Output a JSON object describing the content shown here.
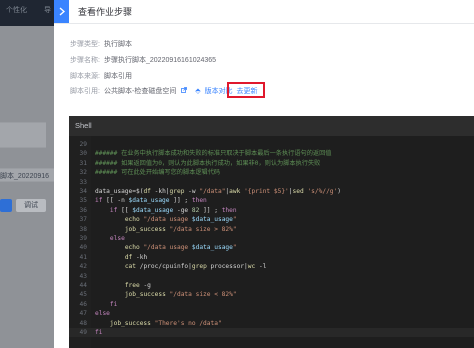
{
  "background_app": {
    "top_nav_items": [
      "个性化",
      "导"
    ],
    "step_name_value": "脚本_20220916",
    "button_label": "调试"
  },
  "panel": {
    "title": "查看作业步骤",
    "collapse_icon": "chevron-right-icon",
    "fields": [
      {
        "label": "步骤类型:",
        "value": "执行脚本"
      },
      {
        "label": "步骤名称:",
        "value": "步骤执行脚本_20220916161024365"
      },
      {
        "label": "脚本来源:",
        "value": "脚本引用"
      },
      {
        "label": "脚本引用:",
        "value": "公共脚本-检查磁盘空间",
        "link_label": "版本对比",
        "update_label": "去更新"
      }
    ]
  },
  "editor": {
    "language_tab": "Shell",
    "lines": [
      {
        "n": "29",
        "text": "",
        "kind": "plain"
      },
      {
        "n": "30",
        "text": "###### 在业务中执行脚本成功和失败的标准只取决于脚本最后一条执行语句的返回值",
        "kind": "comment"
      },
      {
        "n": "31",
        "text": "###### 如果返回值为0，则认为此脚本执行成功，如果非0，则认为脚本执行失败",
        "kind": "comment"
      },
      {
        "n": "32",
        "text": "###### 可在此处开始编写您的脚本逻辑代码",
        "kind": "comment"
      },
      {
        "n": "33",
        "text": "",
        "kind": "plain"
      },
      {
        "n": "34",
        "text": "data_usage=$(df -kh|grep -w \"/data\"|awk '{print $5}'|sed 's/%//g')",
        "kind": "assign"
      },
      {
        "n": "35",
        "text": "if [[ -n $data_usage ]] ; then",
        "kind": "if"
      },
      {
        "n": "36",
        "text": "    if [[ $data_usage -ge 82 ]] ; then",
        "kind": "if"
      },
      {
        "n": "37",
        "text": "        echo \"/data usage $data_usage\"",
        "kind": "echo"
      },
      {
        "n": "38",
        "text": "        job_success \"/data size > 82%\"",
        "kind": "call"
      },
      {
        "n": "39",
        "text": "    else",
        "kind": "kw"
      },
      {
        "n": "40",
        "text": "        echo \"/data usage $data_usage\"",
        "kind": "echo"
      },
      {
        "n": "41",
        "text": "        df -kh",
        "kind": "cmd"
      },
      {
        "n": "42",
        "text": "        cat /proc/cpuinfo|grep processor|wc -l",
        "kind": "cmd"
      },
      {
        "n": "43",
        "text": "",
        "kind": "plain"
      },
      {
        "n": "44",
        "text": "        free -g",
        "kind": "cmd"
      },
      {
        "n": "45",
        "text": "        job_success \"/data size < 82%\"",
        "kind": "call"
      },
      {
        "n": "46",
        "text": "    fi",
        "kind": "kw"
      },
      {
        "n": "47",
        "text": "else",
        "kind": "kw"
      },
      {
        "n": "48",
        "text": "    job_success \"There's no /data\"",
        "kind": "call"
      },
      {
        "n": "49",
        "text": "fi",
        "kind": "kw"
      }
    ]
  }
}
